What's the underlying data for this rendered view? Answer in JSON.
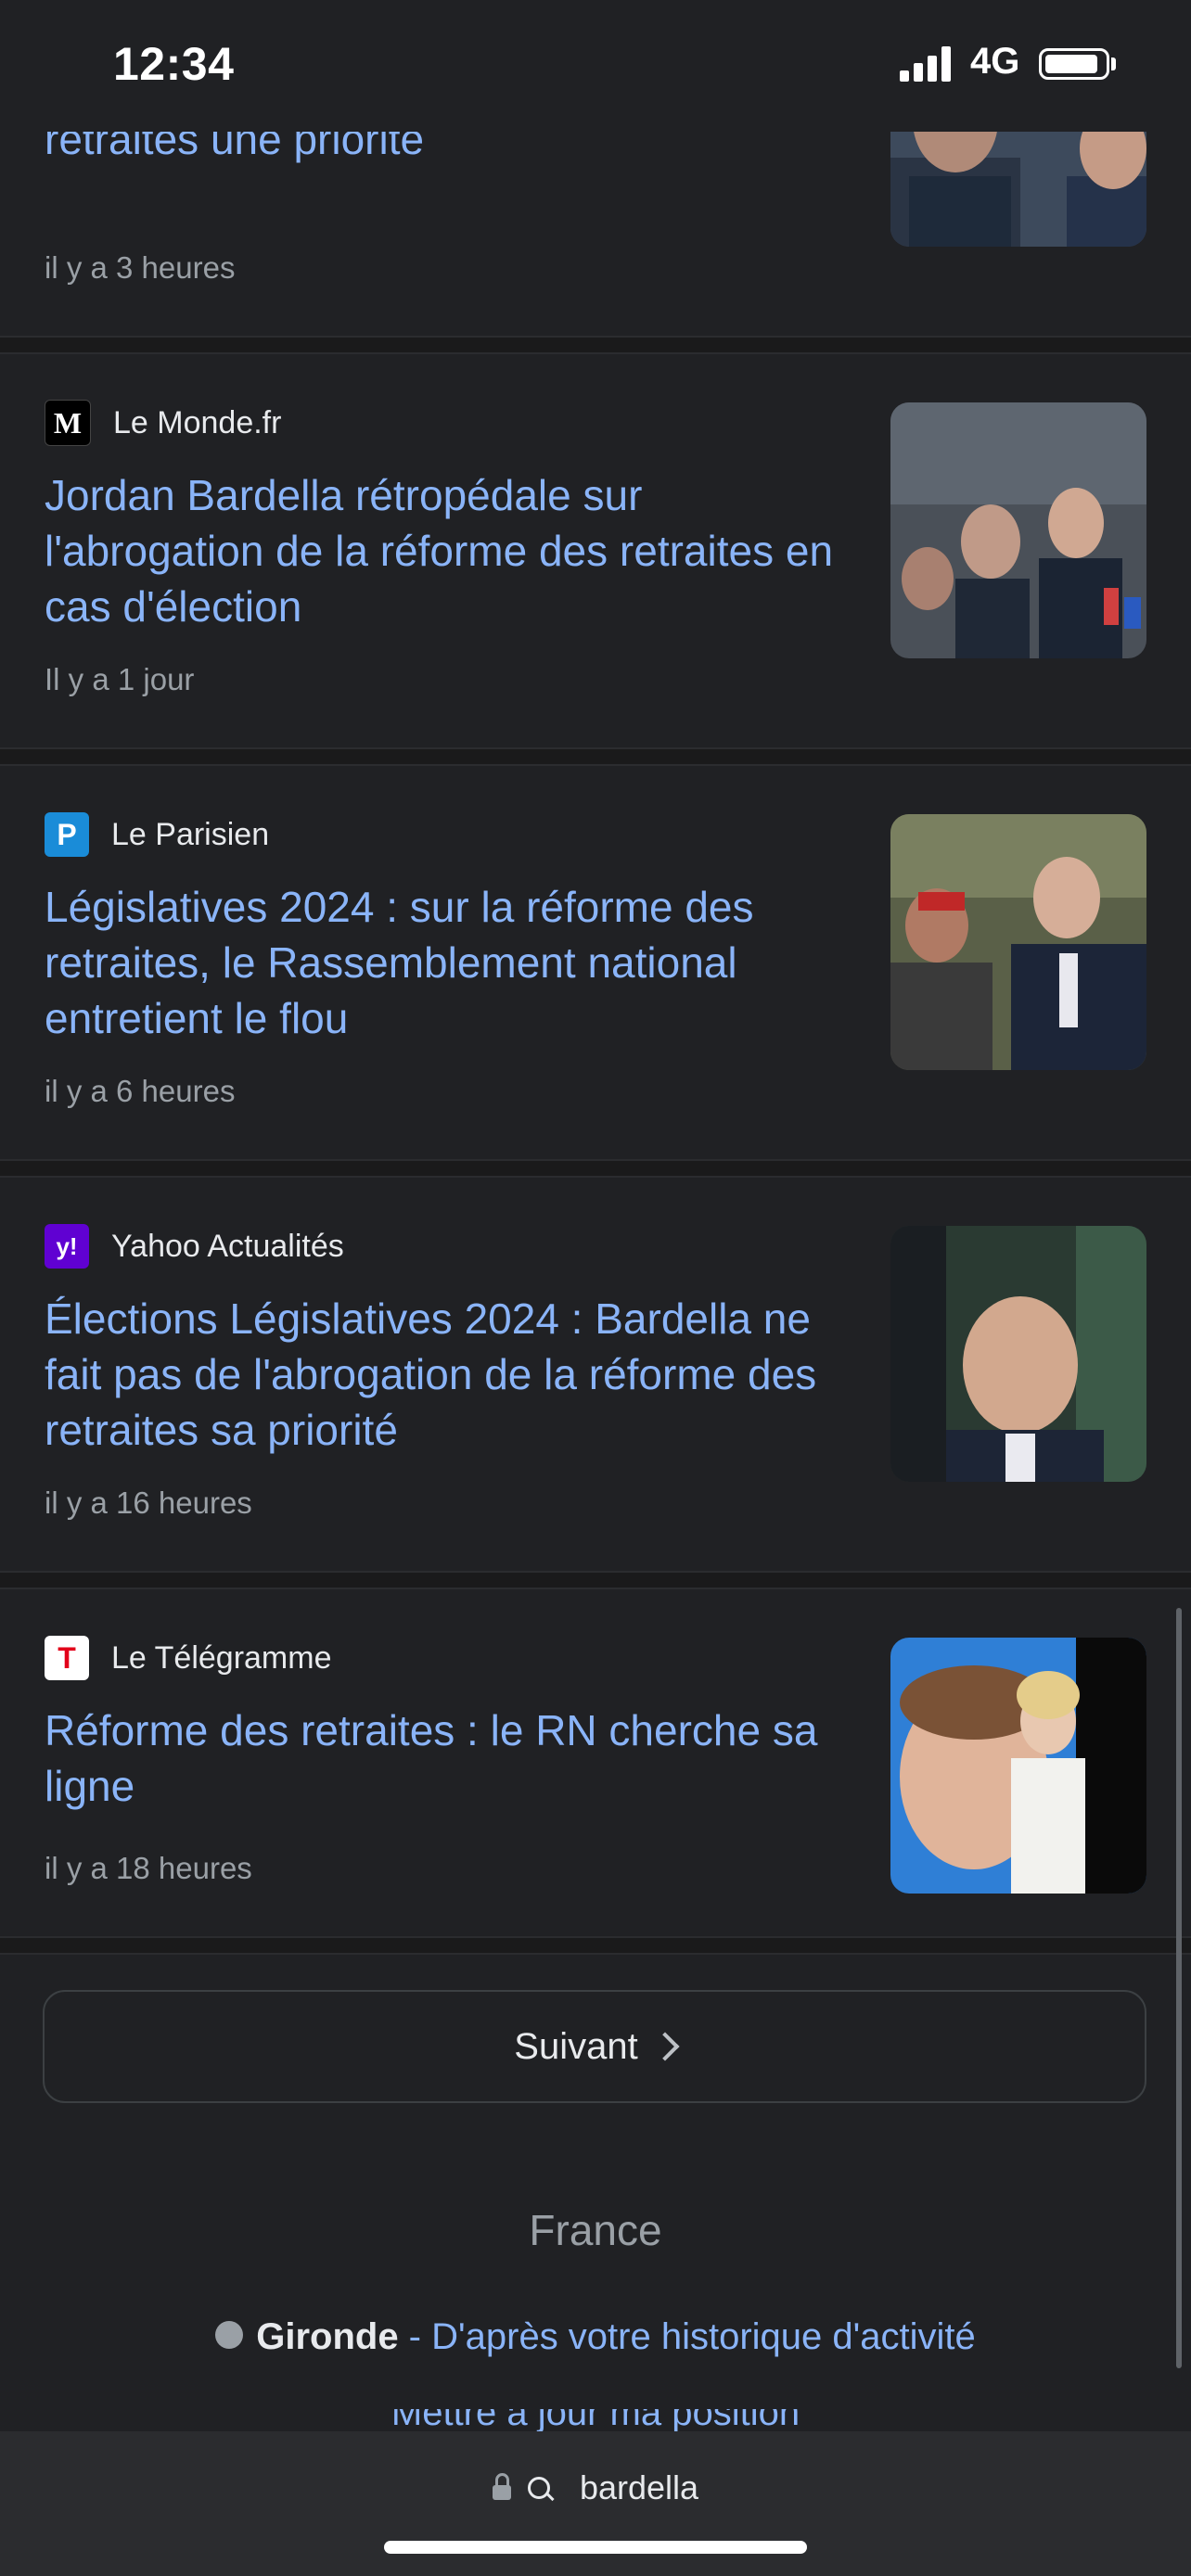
{
  "status": {
    "time": "12:34",
    "network": "4G"
  },
  "articles": [
    {
      "source": "",
      "headline": "fait plus de l'abrogation de la réforme des retraites une priorité",
      "time": "il y a 3 heures"
    },
    {
      "source": "Le Monde.fr",
      "favicon_glyph": "M",
      "favicon_bg": "#000000",
      "headline": "Jordan Bardella rétropédale sur l'abrogation de la réforme des retraites en cas d'élection",
      "time": "Il y a 1 jour"
    },
    {
      "source": "Le Parisien",
      "favicon_glyph": "P",
      "favicon_bg": "#1a8cd8",
      "headline": "Législatives 2024 : sur la réforme des retraites, le Rassemblement national entretient le flou",
      "time": "il y a 6 heures"
    },
    {
      "source": "Yahoo Actualités",
      "favicon_glyph": "y!",
      "favicon_bg": "#6001d2",
      "headline": "Élections Législatives 2024 : Bardella ne fait pas de l'abrogation de la réforme des retraites sa priorité",
      "time": "il y a 16 heures"
    },
    {
      "source": "Le Télégramme",
      "favicon_glyph": "T",
      "favicon_bg": "#ffffff",
      "headline": "Réforme des retraites : le RN cherche sa ligne",
      "time": "il y a 18 heures"
    }
  ],
  "pagination": {
    "next_label": "Suivant"
  },
  "footer": {
    "country": "France",
    "location_name": "Gironde",
    "location_source": " - D'après votre historique d'activité",
    "update_location": "Mettre à jour ma position"
  },
  "address_bar": {
    "query": "bardella"
  },
  "colors": {
    "link": "#8ab4f8",
    "background": "#202124",
    "muted": "#9aa0a6"
  }
}
